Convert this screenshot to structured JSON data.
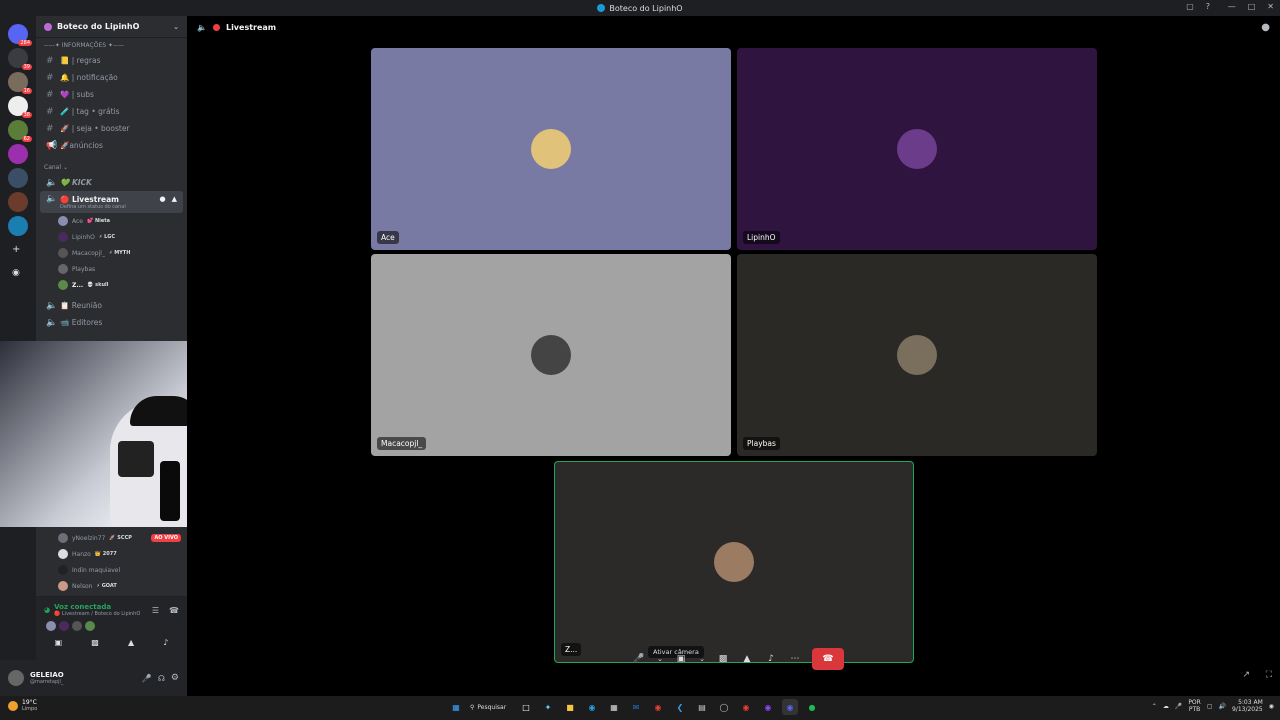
{
  "window": {
    "title": "Boteco do LipinhO"
  },
  "guilds": [
    {
      "color": "#5865f2",
      "badge": "284"
    },
    {
      "color": "#3a3c42",
      "badge": "39"
    },
    {
      "color": "#7a6c5d",
      "badge": "16"
    },
    {
      "color": "#eeeeee",
      "badge": "38"
    },
    {
      "color": "#5a7d3a",
      "badge": "62"
    },
    {
      "color": "#9b2fae",
      "badge": ""
    },
    {
      "color": "#3a4f66",
      "badge": ""
    },
    {
      "color": "#6b3b2b",
      "badge": ""
    },
    {
      "color": "#1a7fb0",
      "badge": ""
    }
  ],
  "server": {
    "name": "Boteco do LipinhO"
  },
  "sidebar": {
    "cat_info": "-----✦ INFORMAÇÕES ✦-----",
    "channels": [
      {
        "icon": "#",
        "label": "📒 | regras"
      },
      {
        "icon": "#",
        "label": "🔔 | notificação"
      },
      {
        "icon": "#",
        "label": "💜 | subs"
      },
      {
        "icon": "#",
        "label": "🧪 | tag • grátis"
      },
      {
        "icon": "#",
        "label": "🚀 | seja • booster"
      },
      {
        "icon": "📢",
        "label": "🚀anúncios"
      }
    ],
    "cat_canal": "Canal",
    "kick_label": "💚 KICK",
    "active_channel": "🔴 Livestream",
    "status_hint": "Defina um status do canal",
    "members": [
      {
        "name": "Ace",
        "tag": "💕 Nieta"
      },
      {
        "name": "LipinhO",
        "tag": "⚡ LGC"
      },
      {
        "name": "Macacopjl_",
        "tag": "⚡ MYTH"
      },
      {
        "name": "Playbas",
        "tag": ""
      },
      {
        "name": "Z...",
        "tag": "💀 skull"
      }
    ],
    "reuniao": "📋 Reunião",
    "editores": "📹 Editores",
    "members2": [
      {
        "name": "yNoelzin77",
        "tag": "🚀 SCCP",
        "live": "AO VIVO"
      },
      {
        "name": "Hanzo",
        "tag": "👑 2077",
        "live": ""
      },
      {
        "name": "Indin maquiavel",
        "tag": "",
        "live": ""
      },
      {
        "name": "Nelson",
        "tag": "⚡ GOAT",
        "live": ""
      }
    ]
  },
  "voice": {
    "status": "Voz conectada",
    "location": "🔴 Livestream / Boteco do LipinhO"
  },
  "user": {
    "name": "GELEIAO",
    "handle": "@marretapjl_"
  },
  "stage": {
    "channel": "Livestream",
    "tiles": [
      {
        "name": "Ace",
        "bg": "#787aa3",
        "av": "#e0c27a"
      },
      {
        "name": "LipinhO",
        "bg": "#2f1440",
        "av": "#6b3c8a"
      },
      {
        "name": "Macacopjl_",
        "bg": "#a3a3a3",
        "av": "#444444"
      },
      {
        "name": "Playbas",
        "bg": "#2a2926",
        "av": "#7a6f5c"
      },
      {
        "name": "Z...",
        "bg": "#2b2a28",
        "av": "#9c7b63"
      }
    ]
  },
  "controls": {
    "tooltip": "Ativar câmera"
  },
  "taskbar": {
    "weather_temp": "19°C",
    "weather_desc": "Limpo",
    "search": "Pesquisar",
    "lang": "POR",
    "lang2": "PTB",
    "time": "5:03 AM",
    "date": "9/13/2025"
  }
}
